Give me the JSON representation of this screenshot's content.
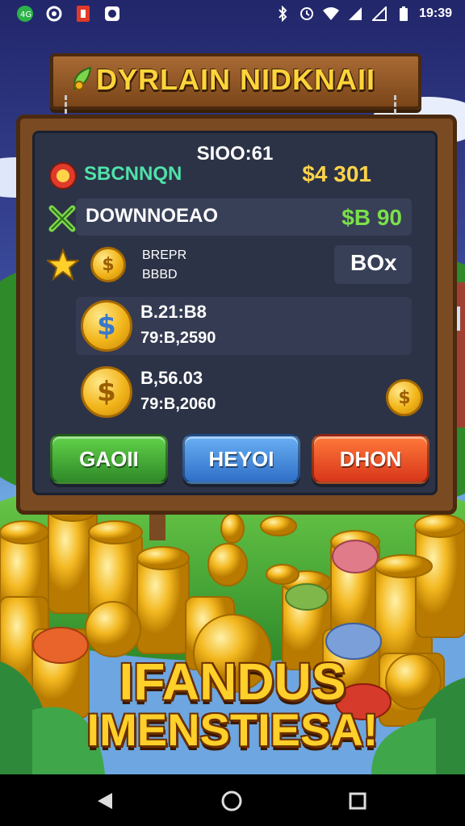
{
  "status_bar": {
    "time": "19:39",
    "left_icons": [
      "app-icon",
      "notification-icon",
      "notification-icon",
      "notification-icon"
    ],
    "right_icons": [
      "bluetooth-icon",
      "alarm-icon",
      "wifi-icon",
      "signal-icon",
      "signal-icon",
      "battery-icon"
    ]
  },
  "title_sign": {
    "title": "DYRLAIN NIDKNAII",
    "icon": "leaf-icon"
  },
  "panel": {
    "header": "SIOO:61",
    "row1": {
      "label": "SBCNNQN",
      "value": "$4 301",
      "icon": "red-target-icon",
      "value_color": "#ffd34a",
      "label_color": "#4fe2a8"
    },
    "row2": {
      "label": "DOWNNOEAO",
      "value": "$B 90",
      "icon": "green-x-icon",
      "value_color": "#7be04a"
    },
    "row3": {
      "label_top": "BREPR",
      "label_bottom": "BBBD",
      "value": "BOx",
      "icon": "star-icon"
    },
    "row4": {
      "line1": "B.21:B8",
      "line2": "79:B,2590",
      "icon": "coin-icon"
    },
    "row5": {
      "line1": "B,56.03",
      "line2": "79:B,2060",
      "icon": "coin-icon"
    }
  },
  "buttons": [
    {
      "label": "GAOII",
      "color": "#3fae3a"
    },
    {
      "label": "HEYOI",
      "color": "#3f86e0"
    },
    {
      "label": "DHON",
      "color": "#e8481e"
    }
  ],
  "promo": {
    "line1": "IFANDUS",
    "line2": "IMENSTIESA!"
  },
  "navbar": {
    "icons": [
      "back-icon",
      "home-icon",
      "recents-icon"
    ]
  },
  "colors": {
    "accent": "#ffcf2a",
    "panel": "#2c3347",
    "wood": "#7a4a22"
  }
}
